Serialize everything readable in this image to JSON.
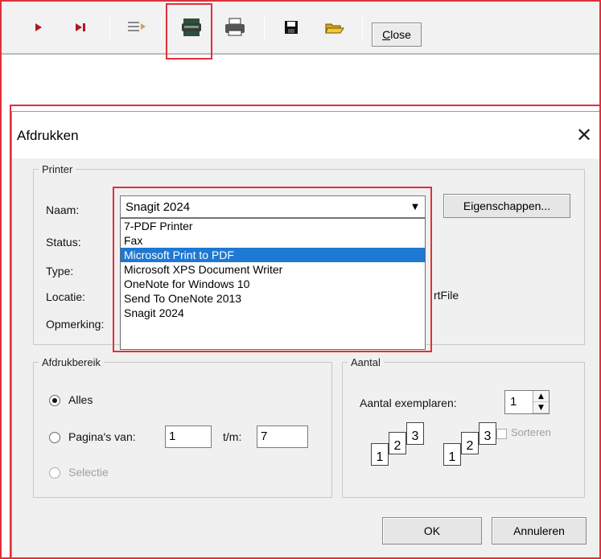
{
  "toolbar": {
    "buttons": [
      {
        "name": "play",
        "glyph": "▶"
      },
      {
        "name": "step",
        "glyph": "▶|"
      },
      {
        "name": "report-list",
        "glyph": "≡▸"
      },
      {
        "name": "print-setup",
        "glyph": "⎙"
      },
      {
        "name": "print",
        "glyph": "⎙"
      },
      {
        "name": "save",
        "glyph": "▪"
      },
      {
        "name": "open",
        "glyph": "▰"
      }
    ],
    "close_label_underlined": "C",
    "close_label_rest": "lose"
  },
  "dialog": {
    "title": "Afdrukken",
    "close_glyph": "✕",
    "printer_group": "Printer",
    "name_label": "Naam:",
    "status_label": "Status:",
    "type_label": "Type:",
    "location_label": "Locatie:",
    "comment_label": "Opmerking:",
    "location_value_partial": "rtFile",
    "selected_printer": "Snagit 2024",
    "properties_button": "Eigenschappen...",
    "printer_options": [
      "7-PDF Printer",
      "Fax",
      "Microsoft Print to PDF",
      "Microsoft XPS Document Writer",
      "OneNote for Windows 10",
      "Send To OneNote 2013",
      "Snagit 2024"
    ],
    "highlighted_option": "Microsoft Print to PDF",
    "range_group": "Afdrukbereik",
    "all_label": "Alles",
    "pages_label": "Pagina's  van:",
    "from_value": "1",
    "to_label": "t/m:",
    "to_value": "7",
    "selection_label": "Selectie",
    "copies_group": "Aantal",
    "copies_label": "Aantal exemplaren:",
    "copies_value": "1",
    "collate_label": "Sorteren",
    "page_nums": [
      "1",
      "2",
      "3"
    ],
    "ok_button": "OK",
    "cancel_button": "Annuleren"
  },
  "colors": {
    "highlight_red": "#e0303a",
    "selection_blue": "#1f78d1",
    "dialog_bg": "#f0f0f0"
  }
}
